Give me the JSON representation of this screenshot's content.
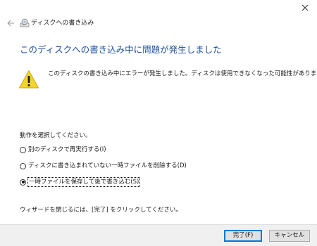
{
  "window": {
    "title": "ディスクへの書き込み",
    "close_icon": "close-icon",
    "back_icon": "back-arrow-icon",
    "disc_icon": "disc-burner-icon"
  },
  "content": {
    "heading": "このディスクへの書き込み中に問題が発生しました",
    "warning_icon": "warning-icon",
    "error_message": "このディスクの書き込み中にエラーが発生しました。ディスクは使用できなくなった可能性があります。",
    "prompt": "動作を選択してください。",
    "options": [
      {
        "label": "別のディスクで再実行する(I)",
        "selected": false
      },
      {
        "label": "ディスクに書き込まれていない一時ファイルを削除する(D)",
        "selected": false
      },
      {
        "label": "一時ファイルを保存して後で書き込む(S)",
        "selected": true
      }
    ],
    "note": "ウィザードを閉じるには、[完了] をクリックしてください。"
  },
  "footer": {
    "finish_label": "完了(F)",
    "cancel_label": "キャンセル"
  },
  "colors": {
    "heading": "#1c4f9c",
    "warning_fill": "#f5d52a",
    "default_button_border": "#0078d7",
    "footer_bg": "#f0f0f0"
  }
}
